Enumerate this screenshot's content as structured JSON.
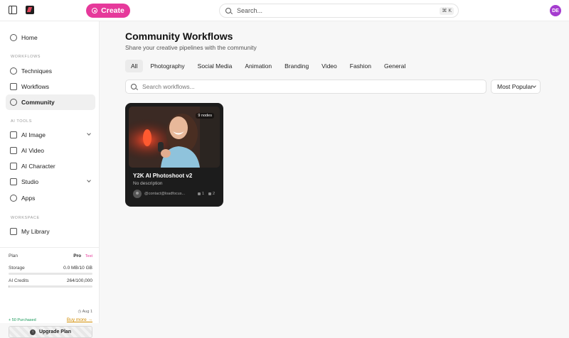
{
  "topbar": {
    "create_label": "Create",
    "search_placeholder": "Search...",
    "shortcut": "⌘ K",
    "avatar_initials": "DE",
    "brand_color": "#e6399b"
  },
  "sidebar": {
    "home": "Home",
    "section_workflows": "WORKFLOWS",
    "techniques": "Techniques",
    "workflows": "Workflows",
    "community": "Community",
    "section_ai_tools": "AI TOOLS",
    "ai_image": "AI Image",
    "ai_video": "AI Video",
    "ai_character": "AI Character",
    "studio": "Studio",
    "apps": "Apps",
    "section_workspace": "WORKSPACE",
    "my_library": "My Library"
  },
  "plan": {
    "plan_label": "Plan",
    "plan_name": "Pro",
    "plan_tag": "Test",
    "storage_label": "Storage",
    "storage_value": "0.0 MB/10 GB",
    "storage_fraction": 0.0,
    "credits_label": "AI Credits",
    "credits_value": "264/100,000",
    "credits_fraction": 0.00264,
    "reset_date": "Aug 1",
    "purchased": "+ 50 Purchased",
    "buy_more": "Buy more →",
    "upgrade_label": "Upgrade Plan"
  },
  "main": {
    "title": "Community Workflows",
    "subtitle": "Share your creative pipelines with the community",
    "tabs": [
      "All",
      "Photography",
      "Social Media",
      "Animation",
      "Branding",
      "Video",
      "Fashion",
      "General"
    ],
    "active_tab": "All",
    "search_placeholder": "Search workflows...",
    "sort_value": "Most Popular"
  },
  "cards": [
    {
      "title": "Y2K AI Photoshoot v2",
      "description": "No description",
      "nodes": "9 nodes",
      "author": "@contact@loadfocus...",
      "likes": "1",
      "views": "2"
    }
  ]
}
